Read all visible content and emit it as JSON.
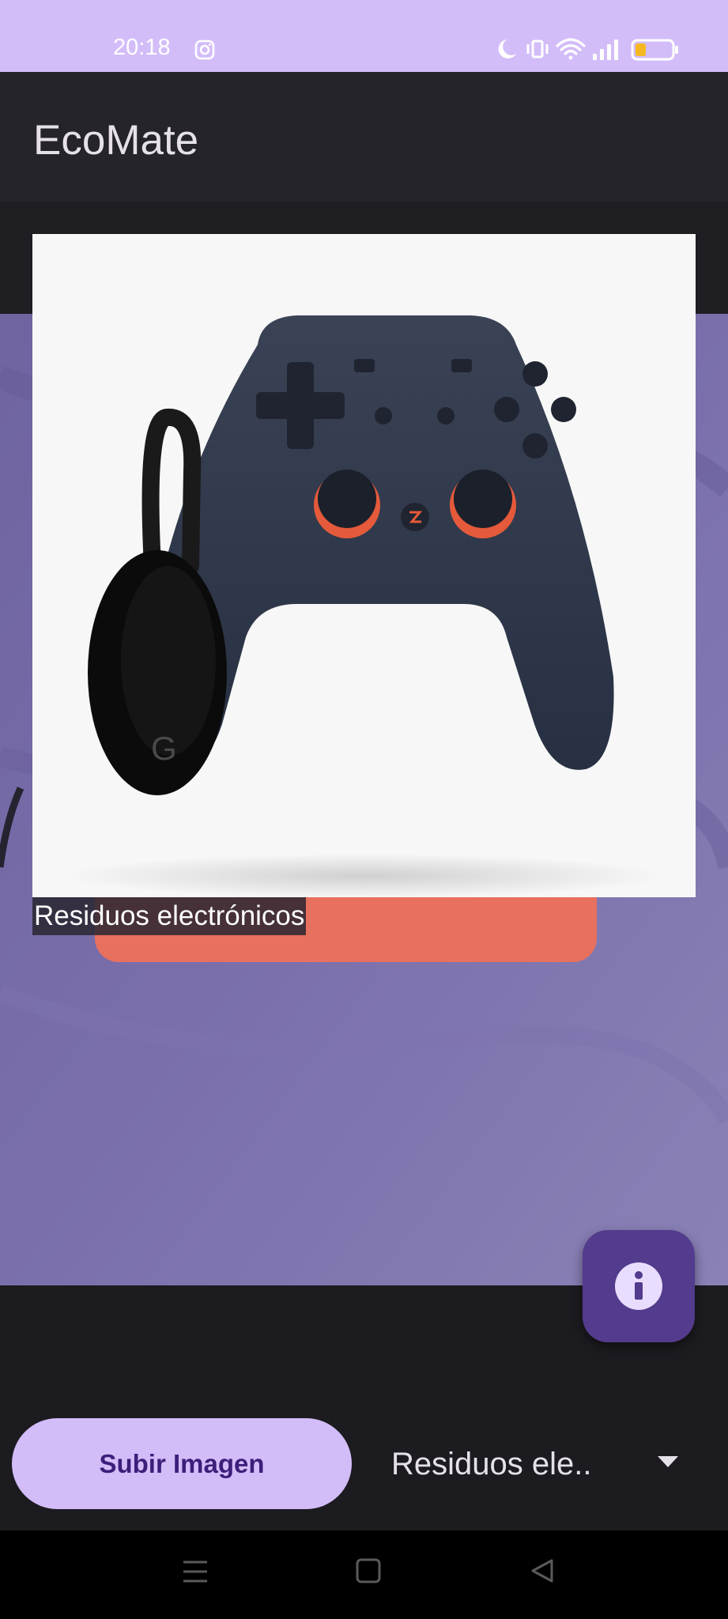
{
  "status_bar": {
    "time": "20:18",
    "icons": [
      "instagram-icon",
      "moon-icon",
      "vibrate-icon",
      "wifi-icon",
      "signal-icon",
      "battery-icon"
    ]
  },
  "app_bar": {
    "title": "EcoMate"
  },
  "classification": {
    "label": "Residuos electrónicos"
  },
  "fab": {
    "icon": "info-icon"
  },
  "controls": {
    "upload_label": "Subir Imagen",
    "dropdown_value": "Residuos ele.."
  },
  "nav_bar": {
    "icons": [
      "menu-icon",
      "home-icon",
      "back-icon"
    ]
  },
  "colors": {
    "accent": "#d3bdf9",
    "fab": "#533b8d",
    "app_bar": "#25242b",
    "background": "#1c1b20"
  }
}
